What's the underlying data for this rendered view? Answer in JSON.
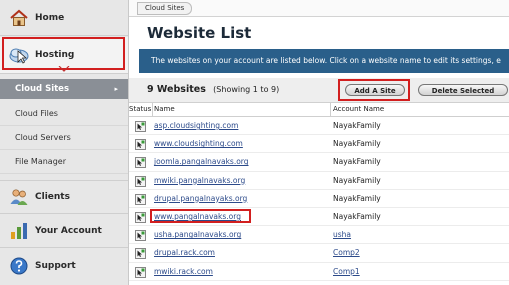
{
  "sidebar": {
    "home_label": "Home",
    "hosting_label": "Hosting",
    "section_label": "Cloud Sites",
    "sub_items": [
      "Cloud Files",
      "Cloud Servers",
      "File Manager"
    ],
    "clients_label": "Clients",
    "account_label": "Your Account",
    "support_label": "Support"
  },
  "breadcrumb": "Cloud Sites",
  "page_title": "Website List",
  "info_text": "The websites on your account are listed below. Click on a website name to edit its settings, e",
  "list_header": {
    "count": "9 Websites",
    "showing": "(Showing 1 to 9)",
    "add_button": "Add A Site",
    "delete_button": "Delete Selected"
  },
  "columns": {
    "status": "Status",
    "name": "Name",
    "account": "Account Name"
  },
  "rows": [
    {
      "name": "asp.cloudsighting.com",
      "account": "NayakFamily"
    },
    {
      "name": "www.cloudsighting.com",
      "account": "NayakFamily"
    },
    {
      "name": "joomla.pangalnavaks.org",
      "account": "NayakFamily"
    },
    {
      "name": "mwiki.pangalnavaks.org",
      "account": "NayakFamily"
    },
    {
      "name": "drupal.pangalnayaks.org",
      "account": "NayakFamily"
    },
    {
      "name": "www.pangalnavaks.org",
      "account": "NayakFamily"
    },
    {
      "name": "usha.pangalnavaks.org",
      "account": "usha"
    },
    {
      "name": "drupal.rack.com",
      "account": "Comp2"
    },
    {
      "name": "mwiki.rack.com",
      "account": "Comp1"
    }
  ],
  "colors": {
    "accent_blue": "#2a5f8a",
    "link": "#2c4a8a",
    "highlight": "#d21f1f",
    "nav_selected": "#8a8f96"
  }
}
